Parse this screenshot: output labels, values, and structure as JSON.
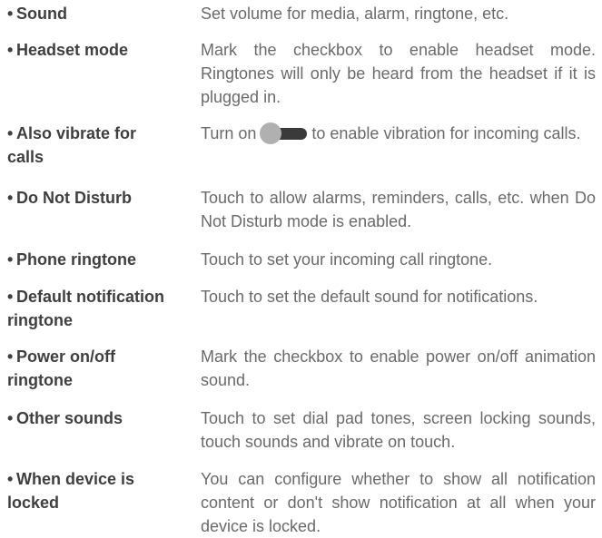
{
  "bullet": "•",
  "settings": [
    {
      "term": "Sound",
      "description": "Set volume for media, alarm, ringtone, etc."
    },
    {
      "term": "Headset mode",
      "description": "Mark the checkbox to enable headset mode. Ringtones will only be heard from the headset if it is plugged in."
    },
    {
      "term": "Also vibrate for calls",
      "description_before": "Turn on",
      "toggle_icon": "toggle-switch-icon",
      "description_after": "to enable vibration for incoming calls."
    },
    {
      "term": "Do Not Disturb",
      "description": "Touch to allow alarms, reminders, calls, etc. when Do Not Disturb mode is enabled."
    },
    {
      "term": "Phone ringtone",
      "description": "Touch to set your incoming call ringtone."
    },
    {
      "term": "Default notification ringtone",
      "description": "Touch to set the default sound for notifications."
    },
    {
      "term": "Power on/off ringtone",
      "description": "Mark the checkbox to enable power on/off animation sound."
    },
    {
      "term": "Other sounds",
      "description": "Touch to set dial pad tones, screen locking sounds, touch sounds and vibrate on touch."
    },
    {
      "term": "When device is locked",
      "description": "You can configure whether to show all notification content or don't show notification at all when your device is locked."
    }
  ],
  "colors": {
    "term_text": "#3f3f3f",
    "description_text": "#6a6a6a",
    "toggle_knob": "#b0b0b0",
    "toggle_track": "#3a3a3a"
  }
}
